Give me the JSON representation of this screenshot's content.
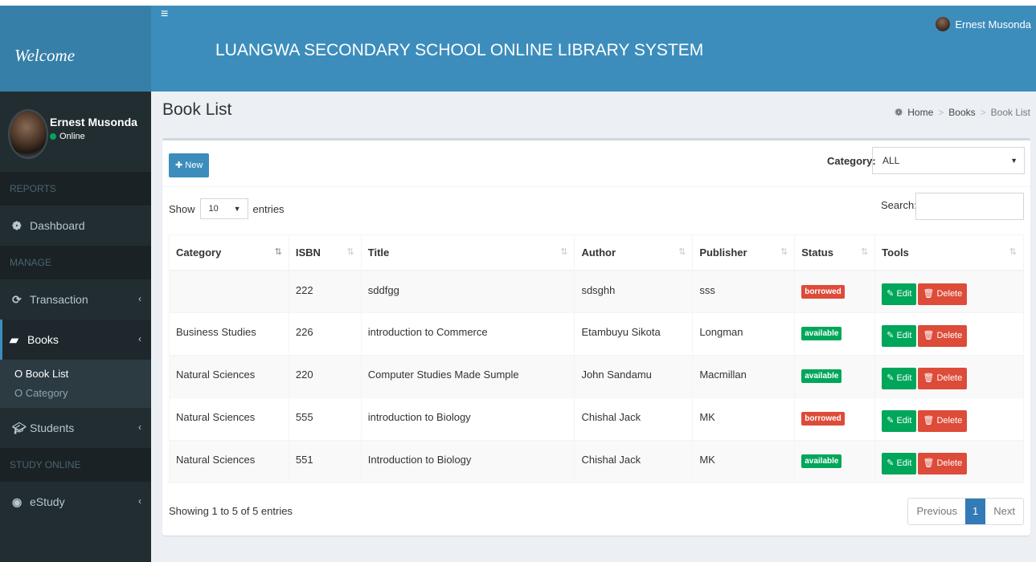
{
  "sidebar": {
    "brand": "Welcome",
    "user": {
      "name": "Ernest Musonda",
      "status": "Online"
    },
    "sections": {
      "reports": "REPORTS",
      "manage": "MANAGE",
      "study": "STUDY ONLINE"
    },
    "items": {
      "dashboard": "Dashboard",
      "transaction": "Transaction",
      "books": "Books",
      "book_list": "Book List",
      "category": "Category",
      "students": "Students",
      "estudy": "eStudy"
    }
  },
  "header": {
    "title": "LUANGWA SECONDARY SCHOOL ONLINE LIBRARY SYSTEM",
    "user": "Ernest Musonda"
  },
  "page": {
    "title": "Book List",
    "breadcrumb": [
      "Home",
      "Books",
      "Book List"
    ]
  },
  "toolbar": {
    "new_label": "New",
    "category_label": "Category:",
    "category_value": "ALL",
    "show_label": "Show",
    "entries_value": "10",
    "entries_label": "entries",
    "search_label": "Search:"
  },
  "table": {
    "columns": [
      "Category",
      "ISBN",
      "Title",
      "Author",
      "Publisher",
      "Status",
      "Tools"
    ],
    "rows": [
      {
        "category": "",
        "isbn": "222",
        "title": "sddfgg",
        "author": "sdsghh",
        "publisher": "sss",
        "status": "borrowed"
      },
      {
        "category": "Business Studies",
        "isbn": "226",
        "title": "introduction to Commerce",
        "author": "Etambuyu Sikota",
        "publisher": "Longman",
        "status": "available"
      },
      {
        "category": "Natural Sciences",
        "isbn": "220",
        "title": "Computer Studies Made Sumple",
        "author": "John Sandamu",
        "publisher": "Macmillan",
        "status": "available"
      },
      {
        "category": "Natural Sciences",
        "isbn": "555",
        "title": "introduction to Biology",
        "author": "Chishal Jack",
        "publisher": "MK",
        "status": "borrowed"
      },
      {
        "category": "Natural Sciences",
        "isbn": "551",
        "title": "Introduction to Biology",
        "author": "Chishal Jack",
        "publisher": "MK",
        "status": "available"
      }
    ],
    "edit_label": "Edit",
    "delete_label": "Delete"
  },
  "footer": {
    "info": "Showing 1 to 5 of 5 entries",
    "previous": "Previous",
    "page": "1",
    "next": "Next"
  },
  "colors": {
    "primary": "#3c8dbc",
    "sidebar": "#222d32",
    "success": "#00a65a",
    "danger": "#dd4b39"
  }
}
